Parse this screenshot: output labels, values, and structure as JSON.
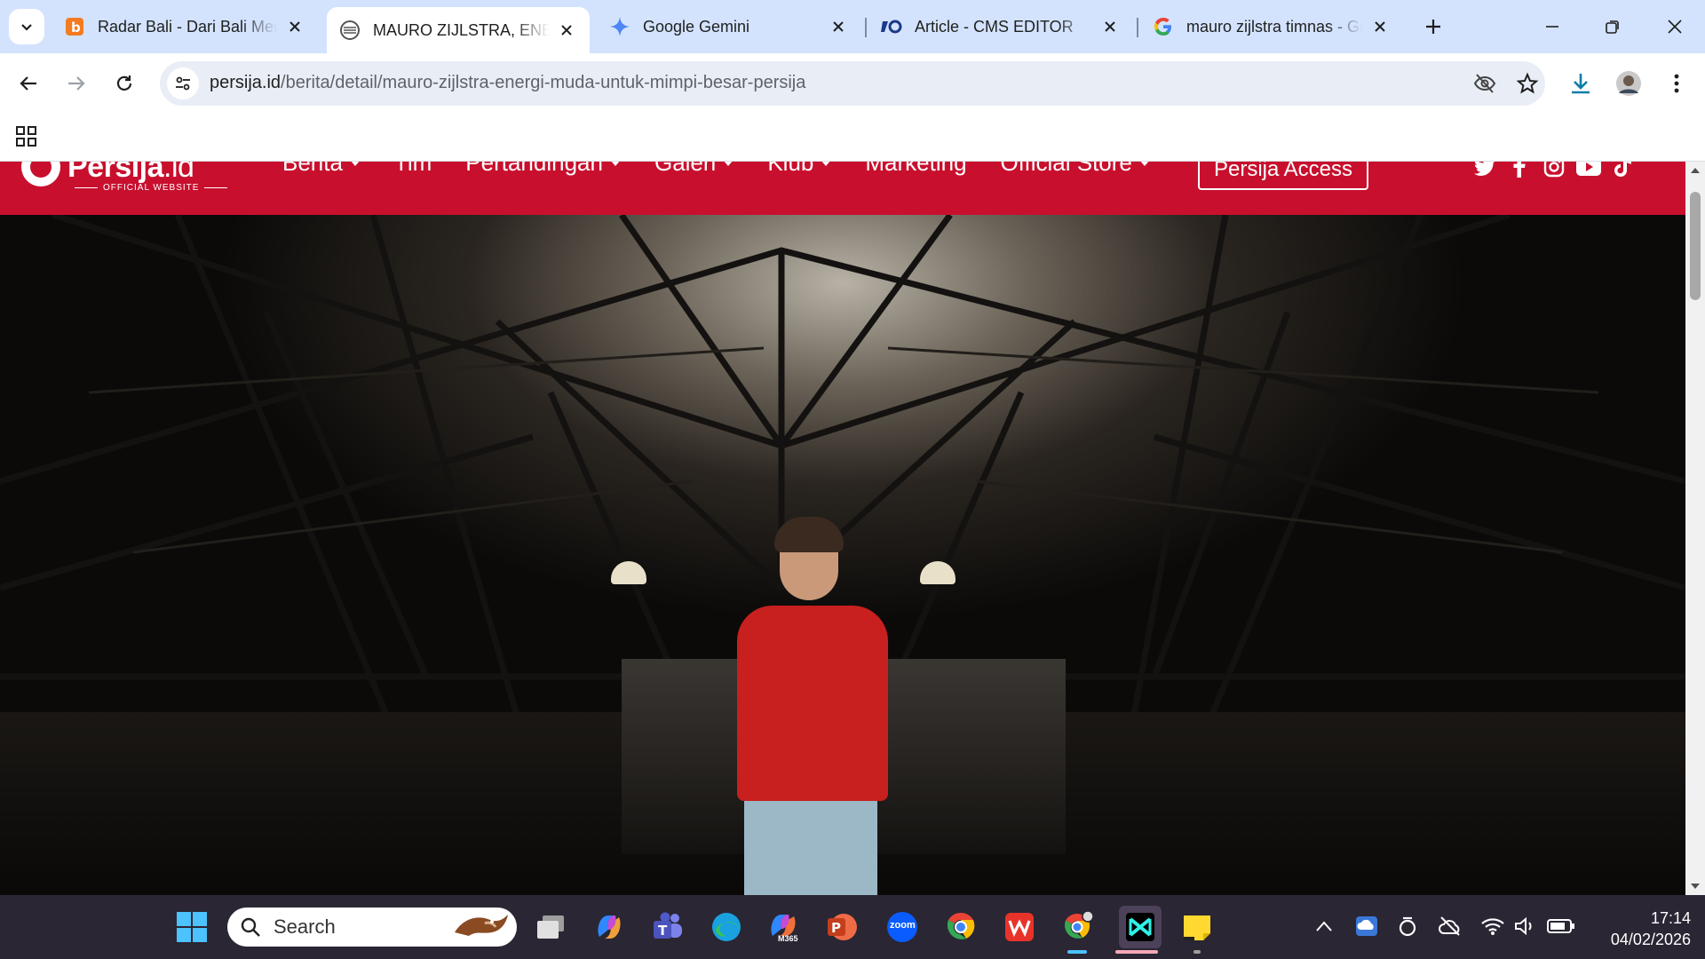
{
  "browser": {
    "tabs": [
      {
        "title": "Radar Bali - Dari Bali Menyapa Dunia",
        "icon": "radar-bali-favicon",
        "active": false
      },
      {
        "title": "MAURO ZIJLSTRA, ENERGI MUDA UNTUK MIMPI BESAR PERSIJA",
        "icon": "persija-favicon",
        "active": true
      },
      {
        "title": "Google Gemini",
        "icon": "gemini-sparkle-icon",
        "active": false
      },
      {
        "title": "Article - CMS EDITOR",
        "icon": "cms-favicon",
        "active": false
      },
      {
        "title": "mauro zijlstra timnas - Google Search",
        "icon": "google-g-icon",
        "active": false
      }
    ],
    "url_host": "persija.id",
    "url_path": "/berita/detail/mauro-zijlstra-energi-muda-untuk-mimpi-besar-persija"
  },
  "site": {
    "logo_name": "Persija",
    "logo_tld": ".id",
    "logo_subtitle": "OFFICIAL WEBSITE",
    "nav": [
      {
        "label": "Berita",
        "dropdown": true
      },
      {
        "label": "Tim",
        "dropdown": false
      },
      {
        "label": "Pertandingan",
        "dropdown": true
      },
      {
        "label": "Galeri",
        "dropdown": true
      },
      {
        "label": "Klub",
        "dropdown": true
      },
      {
        "label": "Marketing",
        "dropdown": false
      },
      {
        "label": "Official Store",
        "dropdown": true
      }
    ],
    "access_button": "Persija Access",
    "socials": [
      "twitter-icon",
      "facebook-icon",
      "instagram-icon",
      "youtube-icon",
      "tiktok-icon"
    ],
    "brand_color": "#c8102e"
  },
  "taskbar": {
    "search_label": "Search",
    "time": "17:14",
    "date": "04/02/2026",
    "zoom_label": "zoom",
    "m365_label": "M365"
  }
}
